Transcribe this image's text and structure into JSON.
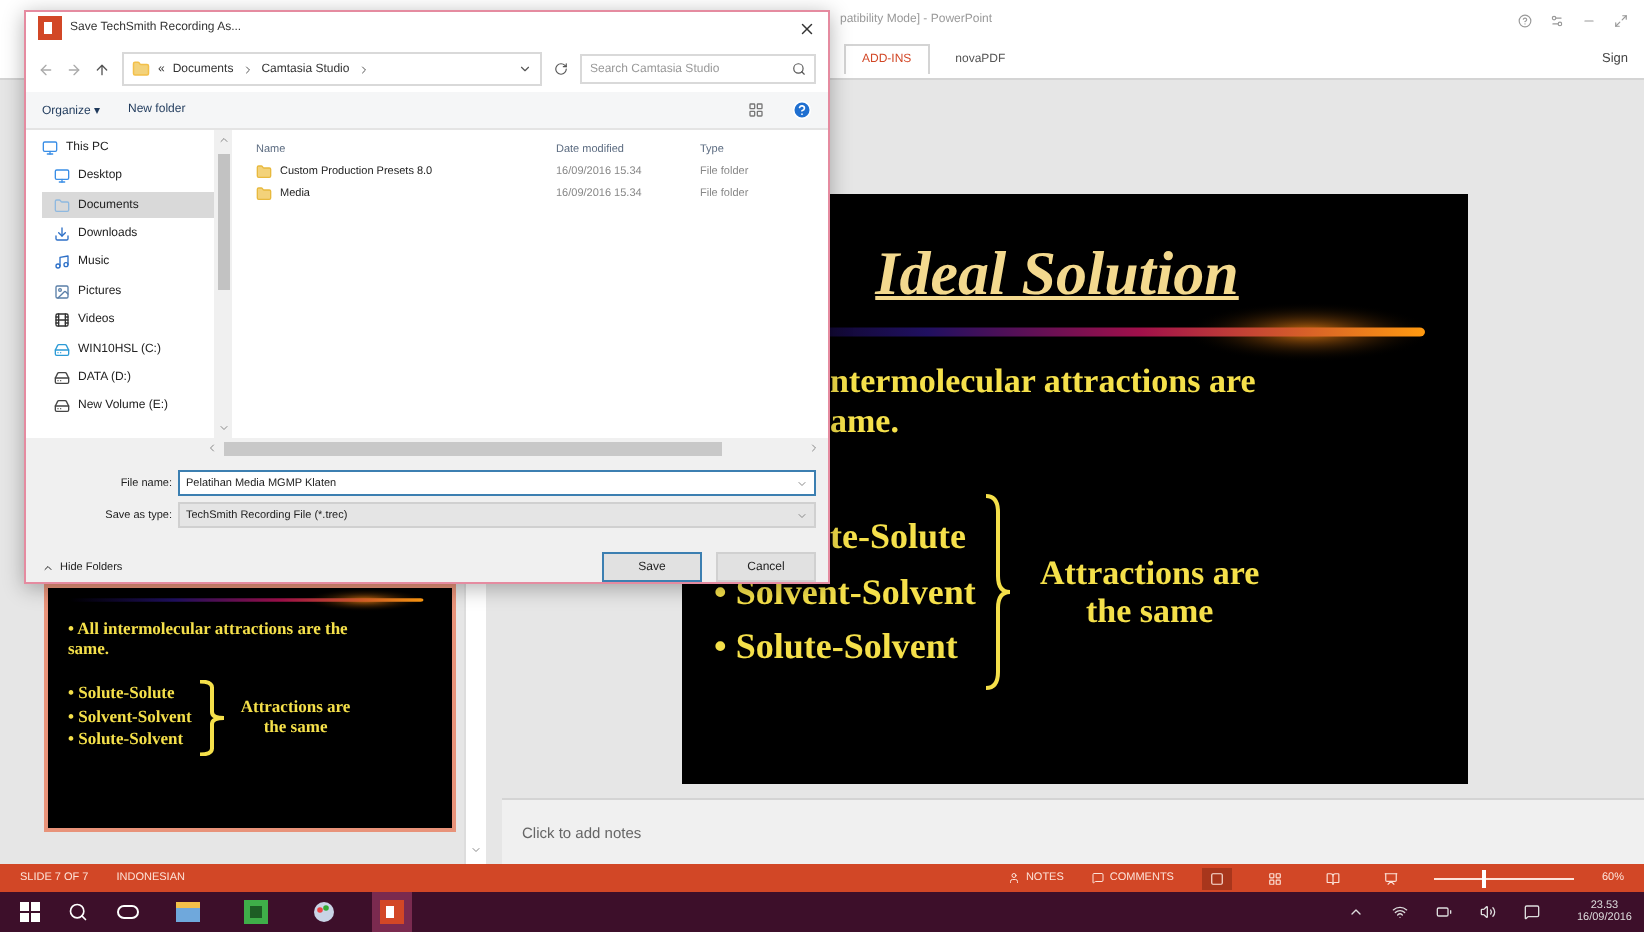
{
  "app": {
    "title": "patibility Mode] - PowerPoint",
    "tabs": [
      {
        "label": "ADD-INS",
        "selected": true
      },
      {
        "label": "novaPDF",
        "selected": false
      }
    ],
    "account": "Sign"
  },
  "thumbnail": {
    "selected": true,
    "lines": [
      {
        "text": "All intermolecular attractions are the same.",
        "bullet": "•"
      }
    ],
    "items": [
      {
        "text": "Solute-Solute",
        "bullet": "•"
      },
      {
        "text": "Solvent-Solvent",
        "bullet": "•"
      },
      {
        "text": "Solute-Solvent",
        "bullet": "•"
      }
    ],
    "group_label": "Attractions are the same"
  },
  "slide": {
    "title": "Ideal Solution",
    "lines": [
      {
        "text": "ntermolecular attractions are"
      },
      {
        "text": "ame."
      }
    ],
    "items": [
      {
        "text": "te-Solute"
      },
      {
        "text": "Solvent-Solvent",
        "bullet": "•"
      },
      {
        "text": "Solute-Solvent",
        "bullet": "•"
      }
    ],
    "group_label": "Attractions are the same"
  },
  "notes": {
    "placeholder": "Click to add notes"
  },
  "status_bar": {
    "slide": "SLIDE 7 OF 7",
    "language": "INDONESIAN",
    "notes": "NOTES",
    "comments": "COMMENTS",
    "views": [
      {
        "kind": "normal",
        "selected": true
      },
      {
        "kind": "sorter",
        "selected": false
      },
      {
        "kind": "reading",
        "selected": false
      },
      {
        "kind": "slideshow",
        "selected": false
      }
    ],
    "zoom": {
      "level": 0.35,
      "reading": "60%"
    }
  },
  "taskbar": {
    "apps": [
      {
        "kind": "explorer",
        "selected": false
      },
      {
        "kind": "camtasia",
        "selected": false
      },
      {
        "kind": "paint",
        "selected": false
      },
      {
        "kind": "powerpoint",
        "selected": true
      }
    ],
    "time": "23.53",
    "date": "16/09/2016"
  },
  "dialog": {
    "title": "Save TechSmith Recording As...",
    "breadcrumb": [
      "«",
      "Documents",
      "Camtasia Studio"
    ],
    "search": {
      "placeholder": "Search Camtasia Studio"
    },
    "toolbar": [
      "Organize ▾",
      "New folder"
    ],
    "nav": [
      {
        "label": "This PC",
        "kind": "pc",
        "selected": false
      },
      {
        "label": "Desktop",
        "kind": "desktop",
        "selected": false
      },
      {
        "label": "Documents",
        "kind": "documents",
        "selected": true
      },
      {
        "label": "Downloads",
        "kind": "downloads",
        "selected": false
      },
      {
        "label": "Music",
        "kind": "music",
        "selected": false
      },
      {
        "label": "Pictures",
        "kind": "pictures",
        "selected": false
      },
      {
        "label": "Videos",
        "kind": "videos",
        "selected": false
      },
      {
        "label": "WIN10HSL (C:)",
        "kind": "system",
        "selected": false
      },
      {
        "label": "DATA (D:)",
        "kind": "drive",
        "selected": false
      },
      {
        "label": "New Volume (E:)",
        "kind": "drive",
        "selected": false
      }
    ],
    "columns": [
      "Name",
      "Date modified",
      "Type"
    ],
    "rows": [
      {
        "name": "Custom Production Presets 8.0",
        "date": "16/09/2016 15.34",
        "type": "File folder"
      },
      {
        "name": "Media",
        "date": "16/09/2016 15.34",
        "type": "File folder"
      }
    ],
    "file_name": {
      "label": "File name:",
      "value": "Pelatihan Media MGMP Klaten"
    },
    "save_type": {
      "label": "Save as type:",
      "value": "TechSmith Recording File (*.trec)"
    },
    "hide_folders": "Hide Folders",
    "buttons": [
      "Save",
      "Cancel"
    ]
  }
}
